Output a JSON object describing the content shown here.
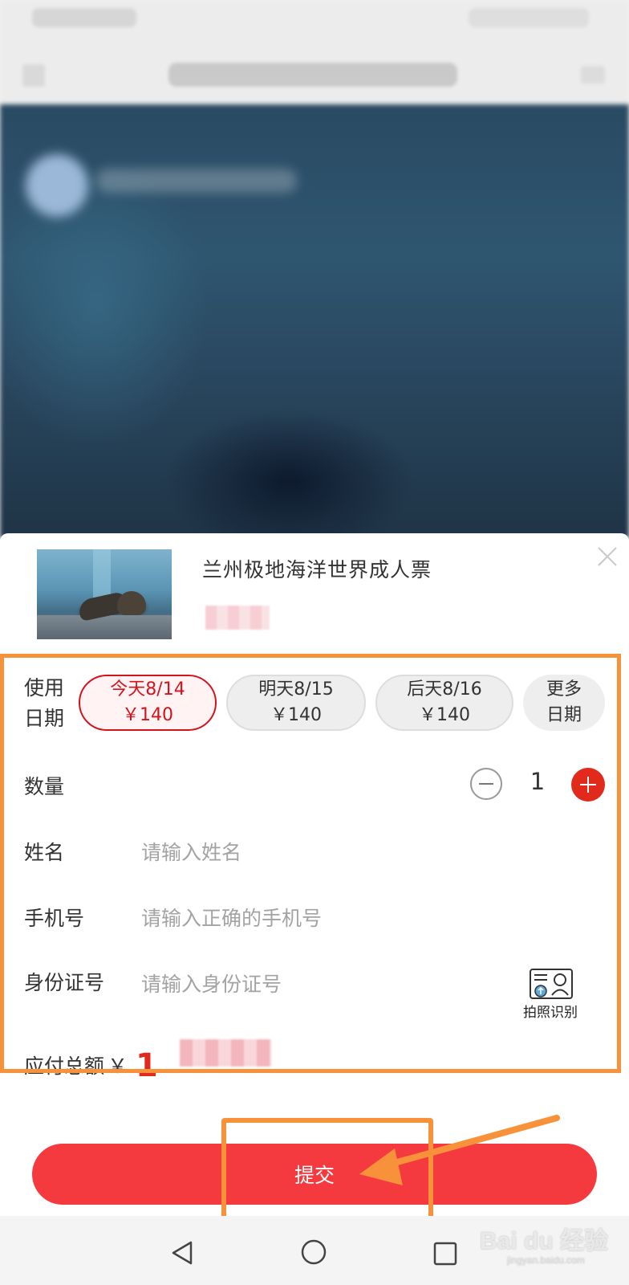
{
  "product": {
    "title": "兰州极地海洋世界成人票"
  },
  "form": {
    "date_label_line1": "使用",
    "date_label_line2": "日期",
    "dates": [
      {
        "day": "今天8/14",
        "price": "￥140",
        "selected": true
      },
      {
        "day": "明天8/15",
        "price": "￥140",
        "selected": false
      },
      {
        "day": "后天8/16",
        "price": "￥140",
        "selected": false
      }
    ],
    "more_dates_line1": "更多",
    "more_dates_line2": "日期",
    "quantity_label": "数量",
    "quantity_value": "1",
    "name_label": "姓名",
    "name_placeholder": "请输入姓名",
    "phone_label": "手机号",
    "phone_placeholder": "请输入正确的手机号",
    "id_label": "身份证号",
    "id_placeholder": "请输入身份证号",
    "id_scan_label": "拍照识别",
    "total_label": "应付总额",
    "total_currency": "￥",
    "total_amount_visible": "1"
  },
  "submit_label": "提交",
  "watermark": {
    "main": "Bai du 经验",
    "sub": "jingyan.baidu.com"
  },
  "colors": {
    "accent_red": "#e1291c",
    "submit_red": "#f53a3f",
    "highlight_orange": "#f7923a"
  },
  "icons": {
    "close": "close-icon",
    "minus": "minus-icon",
    "plus": "plus-icon",
    "id_card": "id-card-scan-icon",
    "nav_back": "nav-back-icon",
    "nav_home": "nav-home-icon",
    "nav_recent": "nav-recent-icon"
  }
}
